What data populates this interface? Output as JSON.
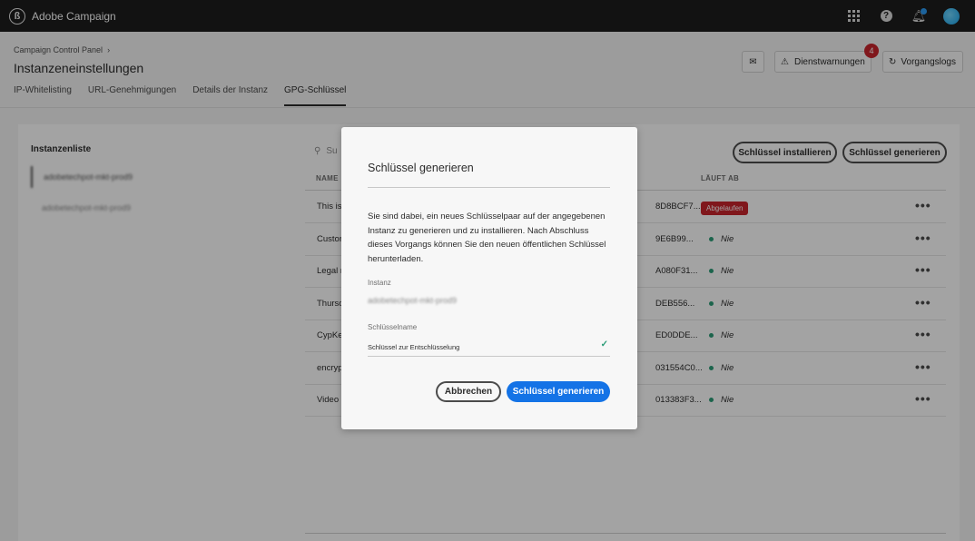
{
  "app": {
    "title": "Adobe Campaign"
  },
  "header": {
    "breadcrumb": "Campaign Control Panel",
    "page_title": "Instanzeneinstellungen",
    "warnings_label": "Dienstwarnungen",
    "warnings_count": "4",
    "logs_label": "Vorgangslogs"
  },
  "tabs": [
    {
      "label": "IP-Whitelisting"
    },
    {
      "label": "URL-Genehmigungen"
    },
    {
      "label": "Details der Instanz"
    },
    {
      "label": "GPG-Schlüssel"
    }
  ],
  "instances": {
    "title": "Instanzenliste",
    "items": [
      "adobetechpot-mkt-prod9",
      "adobetechpot-mkt-prod9"
    ]
  },
  "toolbar": {
    "search_placeholder": "Su",
    "install_label": "Schlüssel installieren",
    "generate_label": "Schlüssel generieren"
  },
  "table": {
    "headers": {
      "name": "NAME",
      "expires": "LÄUFT AB"
    },
    "rows": [
      {
        "name": "This is",
        "fingerprint": "8D8BCF7...",
        "expires": "Abgelaufen",
        "expired": true
      },
      {
        "name": "Custor",
        "fingerprint": "9E6B99...",
        "expires": "Nie",
        "expired": false
      },
      {
        "name": "Legal r",
        "fingerprint": "A080F31...",
        "expires": "Nie",
        "expired": false
      },
      {
        "name": "Thursc",
        "fingerprint": "DEB556...",
        "expires": "Nie",
        "expired": false
      },
      {
        "name": "CypKe",
        "fingerprint": "ED0DDE...",
        "expires": "Nie",
        "expired": false
      },
      {
        "name": "encryp",
        "fingerprint": "031554C0...",
        "expires": "Nie",
        "expired": false
      },
      {
        "name": "Video",
        "fingerprint": "013383F3...",
        "expires": "Nie",
        "expired": false
      }
    ]
  },
  "modal": {
    "title": "Schlüssel generieren",
    "body": "Sie sind dabei, ein neues Schlüsselpaar auf der angegebenen Instanz zu generieren und zu installieren. Nach Abschluss dieses Vorgangs können Sie den neuen öffentlichen Schlüssel herunterladen.",
    "instance_label": "Instanz",
    "instance_value": "adobetechpot-mkt-prod9",
    "key_name_label": "Schlüsselname",
    "key_name_value": "Schlüssel zur Entschlüsselung",
    "cancel_label": "Abbrechen",
    "generate_label": "Schlüssel generieren"
  },
  "colors": {
    "accent": "#1473e6",
    "danger": "#c9252d",
    "success": "#2d9d78",
    "topbar": "#1d1d1d"
  }
}
